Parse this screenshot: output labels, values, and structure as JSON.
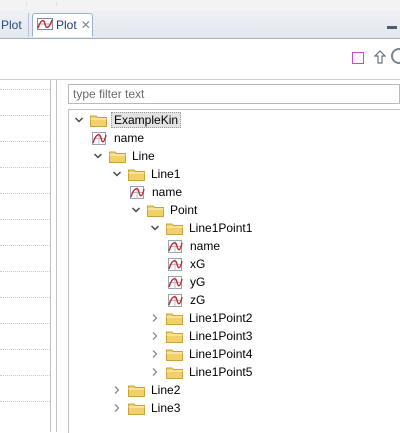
{
  "tabs": [
    {
      "label": "Plot",
      "active": false
    },
    {
      "label": "Plot",
      "active": true,
      "close": "✕"
    }
  ],
  "filter": {
    "placeholder": "type filter text"
  },
  "tree": [
    {
      "label": "ExampleKin",
      "type": "folder",
      "depth": 0,
      "expanded": true,
      "selected": true
    },
    {
      "label": "name",
      "type": "attr",
      "depth": 1
    },
    {
      "label": "Line",
      "type": "folder",
      "depth": 1,
      "expanded": true
    },
    {
      "label": "Line1",
      "type": "folder",
      "depth": 2,
      "expanded": true
    },
    {
      "label": "name",
      "type": "attr",
      "depth": 3
    },
    {
      "label": "Point",
      "type": "folder",
      "depth": 3,
      "expanded": true
    },
    {
      "label": "Line1Point1",
      "type": "folder",
      "depth": 4,
      "expanded": true
    },
    {
      "label": "name",
      "type": "attr",
      "depth": 5
    },
    {
      "label": "xG",
      "type": "attr",
      "depth": 5
    },
    {
      "label": "yG",
      "type": "attr",
      "depth": 5
    },
    {
      "label": "zG",
      "type": "attr",
      "depth": 5
    },
    {
      "label": "Line1Point2",
      "type": "folder",
      "depth": 4,
      "expanded": false
    },
    {
      "label": "Line1Point3",
      "type": "folder",
      "depth": 4,
      "expanded": false
    },
    {
      "label": "Line1Point4",
      "type": "folder",
      "depth": 4,
      "expanded": false
    },
    {
      "label": "Line1Point5",
      "type": "folder",
      "depth": 4,
      "expanded": false
    },
    {
      "label": "Line2",
      "type": "folder",
      "depth": 2,
      "expanded": false
    },
    {
      "label": "Line3",
      "type": "folder",
      "depth": 2,
      "expanded": false
    }
  ],
  "colors": {
    "folder": "#f1cf6b",
    "folder_edge": "#c9a33a",
    "attr_curve": "#c4262e",
    "accent": "#c24fc9"
  },
  "icons": {
    "tab": "plot-icon",
    "toolbar": [
      "square-icon",
      "arrow-up-icon"
    ],
    "tree_folder": "folder-icon",
    "tree_attr": "attribute-icon"
  }
}
